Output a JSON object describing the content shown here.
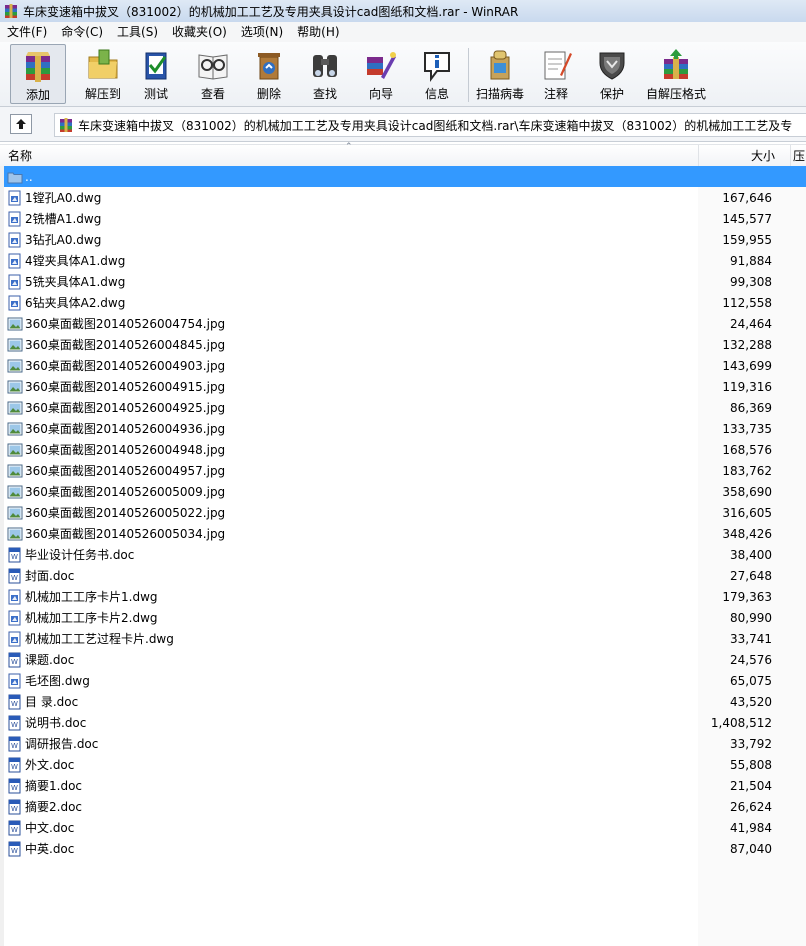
{
  "window": {
    "title": "车床变速箱中拔叉（831002）的机械加工工艺及专用夹具设计cad图纸和文档.rar - WinRAR"
  },
  "menu": [
    "文件(F)",
    "命令(C)",
    "工具(S)",
    "收藏夹(O)",
    "选项(N)",
    "帮助(H)"
  ],
  "toolbar": {
    "buttons": [
      {
        "label": "添加",
        "icon": "add-archive-icon"
      },
      {
        "label": "解压到",
        "icon": "extract-to-icon"
      },
      {
        "label": "测试",
        "icon": "test-icon"
      },
      {
        "label": "查看",
        "icon": "view-icon"
      },
      {
        "label": "删除",
        "icon": "delete-icon"
      },
      {
        "label": "查找",
        "icon": "find-icon"
      },
      {
        "label": "向导",
        "icon": "wizard-icon"
      },
      {
        "label": "信息",
        "icon": "info-icon"
      },
      {
        "label": "扫描病毒",
        "icon": "virus-scan-icon"
      },
      {
        "label": "注释",
        "icon": "comment-icon"
      },
      {
        "label": "保护",
        "icon": "protect-icon"
      },
      {
        "label": "自解压格式",
        "icon": "sfx-icon"
      }
    ]
  },
  "address": {
    "path": "车床变速箱中拔叉（831002）的机械加工工艺及专用夹具设计cad图纸和文档.rar\\车床变速箱中拔叉（831002）的机械加工工艺及专"
  },
  "columns": {
    "name": "名称",
    "size": "大小",
    "packed": "压缩"
  },
  "colors": {
    "selection": "#3399ff"
  },
  "files": [
    {
      "name": "..",
      "size": "",
      "type": "folder"
    },
    {
      "name": "1镗孔A0.dwg",
      "size": "167,646",
      "type": "dwg"
    },
    {
      "name": "2铣槽A1.dwg",
      "size": "145,577",
      "type": "dwg"
    },
    {
      "name": "3钻孔A0.dwg",
      "size": "159,955",
      "type": "dwg"
    },
    {
      "name": "4镗夹具体A1.dwg",
      "size": "91,884",
      "type": "dwg"
    },
    {
      "name": "5铣夹具体A1.dwg",
      "size": "99,308",
      "type": "dwg"
    },
    {
      "name": "6钻夹具体A2.dwg",
      "size": "112,558",
      "type": "dwg"
    },
    {
      "name": "360桌面截图20140526004754.jpg",
      "size": "24,464",
      "type": "jpg"
    },
    {
      "name": "360桌面截图20140526004845.jpg",
      "size": "132,288",
      "type": "jpg"
    },
    {
      "name": "360桌面截图20140526004903.jpg",
      "size": "143,699",
      "type": "jpg"
    },
    {
      "name": "360桌面截图20140526004915.jpg",
      "size": "119,316",
      "type": "jpg"
    },
    {
      "name": "360桌面截图20140526004925.jpg",
      "size": "86,369",
      "type": "jpg"
    },
    {
      "name": "360桌面截图20140526004936.jpg",
      "size": "133,735",
      "type": "jpg"
    },
    {
      "name": "360桌面截图20140526004948.jpg",
      "size": "168,576",
      "type": "jpg"
    },
    {
      "name": "360桌面截图20140526004957.jpg",
      "size": "183,762",
      "type": "jpg"
    },
    {
      "name": "360桌面截图20140526005009.jpg",
      "size": "358,690",
      "type": "jpg"
    },
    {
      "name": "360桌面截图20140526005022.jpg",
      "size": "316,605",
      "type": "jpg"
    },
    {
      "name": "360桌面截图20140526005034.jpg",
      "size": "348,426",
      "type": "jpg"
    },
    {
      "name": "毕业设计任务书.doc",
      "size": "38,400",
      "type": "doc"
    },
    {
      "name": "封面.doc",
      "size": "27,648",
      "type": "doc"
    },
    {
      "name": "机械加工工序卡片1.dwg",
      "size": "179,363",
      "type": "dwg"
    },
    {
      "name": "机械加工工序卡片2.dwg",
      "size": "80,990",
      "type": "dwg"
    },
    {
      "name": "机械加工工艺过程卡片.dwg",
      "size": "33,741",
      "type": "dwg"
    },
    {
      "name": "课题.doc",
      "size": "24,576",
      "type": "doc"
    },
    {
      "name": "毛坯图.dwg",
      "size": "65,075",
      "type": "dwg"
    },
    {
      "name": "目  录.doc",
      "size": "43,520",
      "type": "doc"
    },
    {
      "name": "说明书.doc",
      "size": "1,408,512",
      "type": "doc"
    },
    {
      "name": "调研报告.doc",
      "size": "33,792",
      "type": "doc"
    },
    {
      "name": "外文.doc",
      "size": "55,808",
      "type": "doc"
    },
    {
      "name": "摘要1.doc",
      "size": "21,504",
      "type": "doc"
    },
    {
      "name": "摘要2.doc",
      "size": "26,624",
      "type": "doc"
    },
    {
      "name": "中文.doc",
      "size": "41,984",
      "type": "doc"
    },
    {
      "name": "中英.doc",
      "size": "87,040",
      "type": "doc"
    }
  ]
}
